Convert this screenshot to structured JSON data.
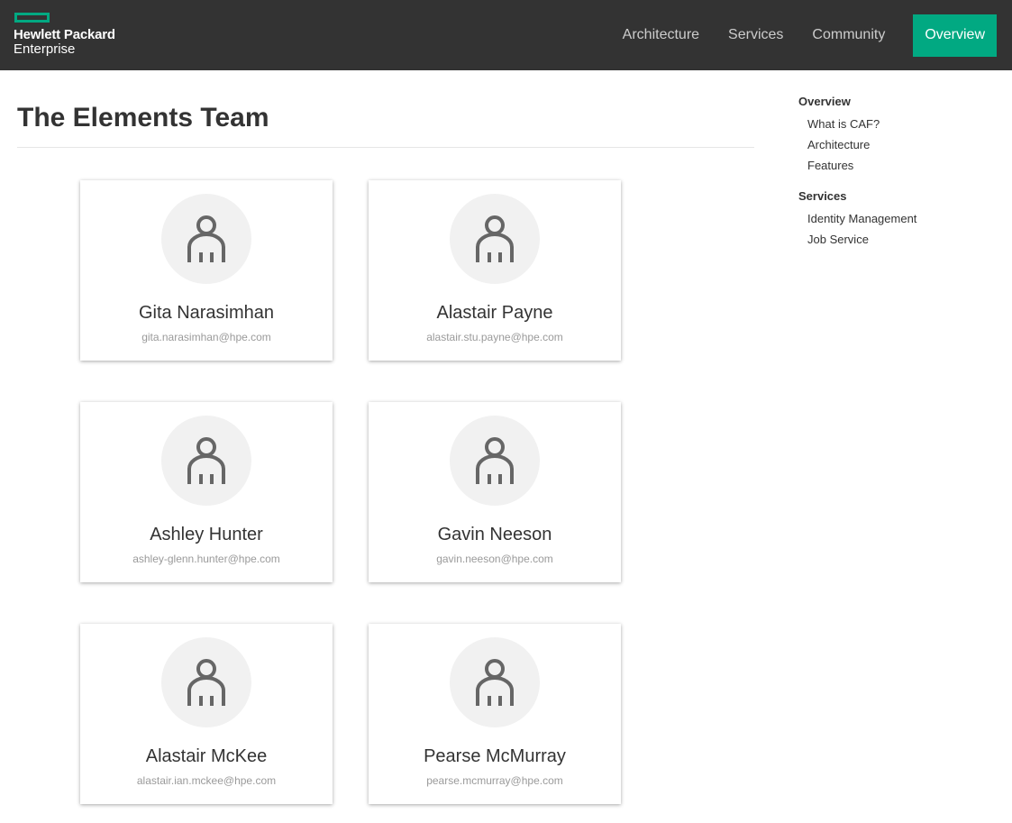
{
  "header": {
    "logo_line1": "Hewlett Packard",
    "logo_line2": "Enterprise",
    "nav": [
      {
        "label": "Architecture"
      },
      {
        "label": "Services"
      },
      {
        "label": "Community"
      }
    ],
    "cta_label": "Overview",
    "colors": {
      "bar": "#333333",
      "accent": "#01a982"
    }
  },
  "main": {
    "title": "The Elements Team",
    "members": [
      {
        "name": "Gita Narasimhan",
        "email": "gita.narasimhan@hpe.com",
        "icon": "user-icon"
      },
      {
        "name": "Alastair Payne",
        "email": "alastair.stu.payne@hpe.com",
        "icon": "user-icon"
      },
      {
        "name": "Ashley Hunter",
        "email": "ashley-glenn.hunter@hpe.com",
        "icon": "user-icon"
      },
      {
        "name": "Gavin Neeson",
        "email": "gavin.neeson@hpe.com",
        "icon": "user-icon"
      },
      {
        "name": "Alastair McKee",
        "email": "alastair.ian.mckee@hpe.com",
        "icon": "user-icon"
      },
      {
        "name": "Pearse McMurray",
        "email": "pearse.mcmurray@hpe.com",
        "icon": "user-icon"
      }
    ]
  },
  "sidenav": {
    "sections": [
      {
        "heading": "Overview",
        "links": [
          "What is CAF?",
          "Architecture",
          "Features"
        ]
      },
      {
        "heading": "Services",
        "links": [
          "Identity Management",
          "Job Service"
        ]
      }
    ]
  }
}
